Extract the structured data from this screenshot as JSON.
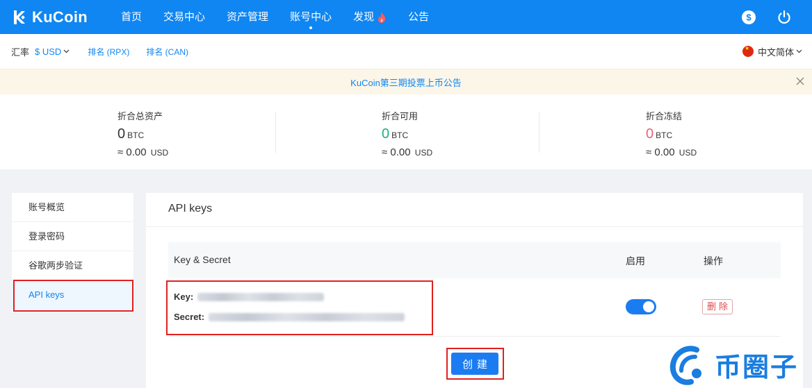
{
  "brand": {
    "name": "KuCoin",
    "accent": "#0f86f2"
  },
  "nav": {
    "items": [
      {
        "label": "首页"
      },
      {
        "label": "交易中心"
      },
      {
        "label": "资产管理"
      },
      {
        "label": "账号中心",
        "active": true
      },
      {
        "label": "发现",
        "icon": "fire-icon"
      },
      {
        "label": "公告"
      }
    ],
    "right_icons": [
      "dollar-icon",
      "power-icon"
    ]
  },
  "subbar": {
    "rate_label": "汇率",
    "rate_value": "$ USD",
    "rank_links": [
      "排名 (RPX)",
      "排名 (CAN)"
    ],
    "language": "中文简体"
  },
  "announcement": {
    "text": "KuCoin第三期投票上币公告"
  },
  "assets": [
    {
      "title": "折合总资产",
      "amount": "0",
      "unit": "BTC",
      "usd": "≈ 0.00",
      "usd_unit": "USD",
      "color": "#333333"
    },
    {
      "title": "折合可用",
      "amount": "0",
      "unit": "BTC",
      "usd": "≈ 0.00",
      "usd_unit": "USD",
      "color": "#1bb07a"
    },
    {
      "title": "折合冻结",
      "amount": "0",
      "unit": "BTC",
      "usd": "≈ 0.00",
      "usd_unit": "USD",
      "color": "#f0607a"
    }
  ],
  "sidebar": {
    "items": [
      {
        "label": "账号概览"
      },
      {
        "label": "登录密码"
      },
      {
        "label": "谷歌两步验证"
      },
      {
        "label": "API keys",
        "active": true
      }
    ]
  },
  "panel": {
    "title": "API keys",
    "columns": [
      "Key & Secret",
      "启用",
      "操作"
    ],
    "row": {
      "key_label": "Key:",
      "secret_label": "Secret:",
      "enabled": true,
      "delete_label": "删除"
    },
    "create_label": "创建"
  },
  "watermark": {
    "text": "币圈子"
  }
}
